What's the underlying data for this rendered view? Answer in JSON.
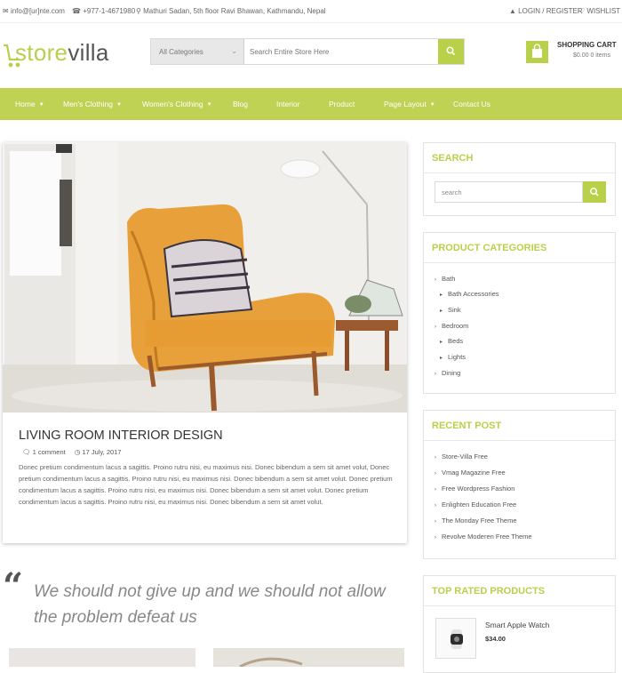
{
  "topbar": {
    "email": "info@[ur]nte.com",
    "phone": "+977-1-4671980",
    "address": "Mathuri Sadan, 5th floor Ravi Bhawan, Kathmandu, Nepal",
    "login": "LOGIN / REGISTER",
    "wishlist": "WISHLIST"
  },
  "header": {
    "logo_a": "store",
    "logo_b": "villa",
    "category_select": "All Categories",
    "search_placeholder": "Search Entire Store Here",
    "cart_title": "SHOPPING CART",
    "cart_summary": "$0.00 0 items"
  },
  "nav": [
    {
      "label": "Home",
      "dropdown": true
    },
    {
      "label": "Men's Clothing",
      "dropdown": true
    },
    {
      "label": "Women's Clothing",
      "dropdown": true
    },
    {
      "label": "Blog",
      "dropdown": false
    },
    {
      "label": "Interior",
      "dropdown": false
    },
    {
      "label": "Product",
      "dropdown": false
    },
    {
      "label": "Page Layout",
      "dropdown": true
    },
    {
      "label": "Contact Us",
      "dropdown": false
    }
  ],
  "post": {
    "title": "LIVING ROOM INTERIOR DESIGN",
    "comments": "1 comment",
    "date": "17 July, 2017",
    "body": "Donec pretium condimentum lacus a sagittis. Proino rutru nisi, eu maximus nisi. Donec bibendum a sem sit amet volut, Donec pretium condimentum lacus a sagittis. Proino rutru nisi, eu maximus nisi. Donec bibendum a sem sit amet volut. Donec pretium condimentum lacus a sagittis. Proino rutru nisi, eu maximus nisi. Donec bibendum a sem sit amet volut. Donec pretium condimentum lacus a sagittis. Proino rutru nisi, eu maximus nisi. Donec bibendum a sem sit amet volut."
  },
  "quote": {
    "text": "We should not give up and we should not allow the problem defeat us"
  },
  "sidebar": {
    "search": {
      "title": "SEARCH",
      "placeholder": "search"
    },
    "categories": {
      "title": "PRODUCT CATEGORIES",
      "items": [
        {
          "label": "Bath",
          "level": 0
        },
        {
          "label": "Bath Accessories",
          "level": 1
        },
        {
          "label": "Sink",
          "level": 1
        },
        {
          "label": "Bedroom",
          "level": 0
        },
        {
          "label": "Beds",
          "level": 1
        },
        {
          "label": "Lights",
          "level": 1
        },
        {
          "label": "Dining",
          "level": 0
        }
      ]
    },
    "recent": {
      "title": "RECENT POST",
      "items": [
        "Store-Villa Free",
        "Vmag Magazine Free",
        "Free Wordpress Fashion",
        "Enlighten Education Free",
        "The Monday Free Theme",
        "Revolve Moderen Free Theme"
      ]
    },
    "top_rated": {
      "title": "TOP RATED PRODUCTS",
      "product_name": "Smart Apple Watch",
      "product_price": "$34.00"
    }
  },
  "colors": {
    "accent": "#bfd253",
    "text": "#555555"
  }
}
